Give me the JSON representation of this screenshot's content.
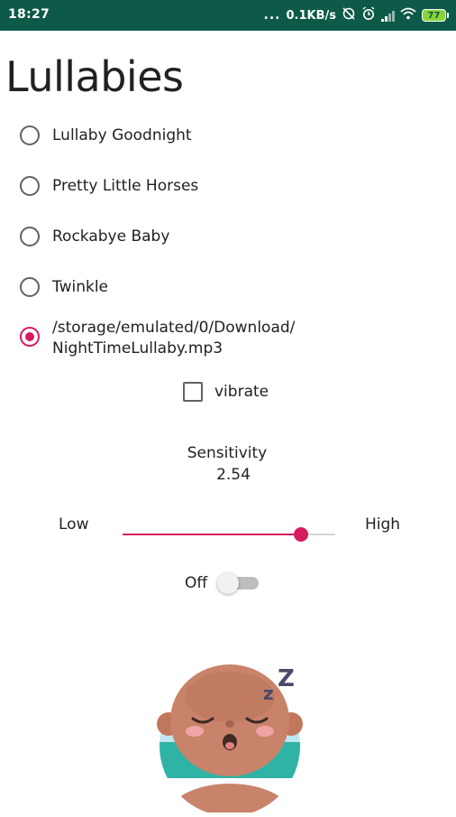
{
  "status_bar": {
    "time": "18:27",
    "dots": "...",
    "network_speed": "0.1KB/s",
    "battery_level": "77",
    "colors": {
      "background": "#0c5a47",
      "battery": "#8ad43b"
    },
    "icons": [
      "sync-off-icon",
      "alarm-icon",
      "signal-icon",
      "wifi-icon",
      "battery-icon"
    ]
  },
  "title": "Lullabies",
  "options": [
    {
      "label": "Lullaby Goodnight",
      "selected": false
    },
    {
      "label": "Pretty Little Horses",
      "selected": false
    },
    {
      "label": "Rockabye Baby",
      "selected": false
    },
    {
      "label": "Twinkle",
      "selected": false
    },
    {
      "label_line1": "/storage/emulated/0/Download/",
      "label_line2": "NightTimeLullaby.mp3",
      "selected": true
    }
  ],
  "vibrate": {
    "label": "vibrate",
    "checked": false
  },
  "sensitivity": {
    "title": "Sensitivity",
    "value": "2.54",
    "low_label": "Low",
    "high_label": "High",
    "slider_fraction": 0.84
  },
  "power_switch": {
    "label": "Off",
    "on": false
  },
  "accent_color": "#d81b60",
  "illustration": "sleeping-baby-icon"
}
